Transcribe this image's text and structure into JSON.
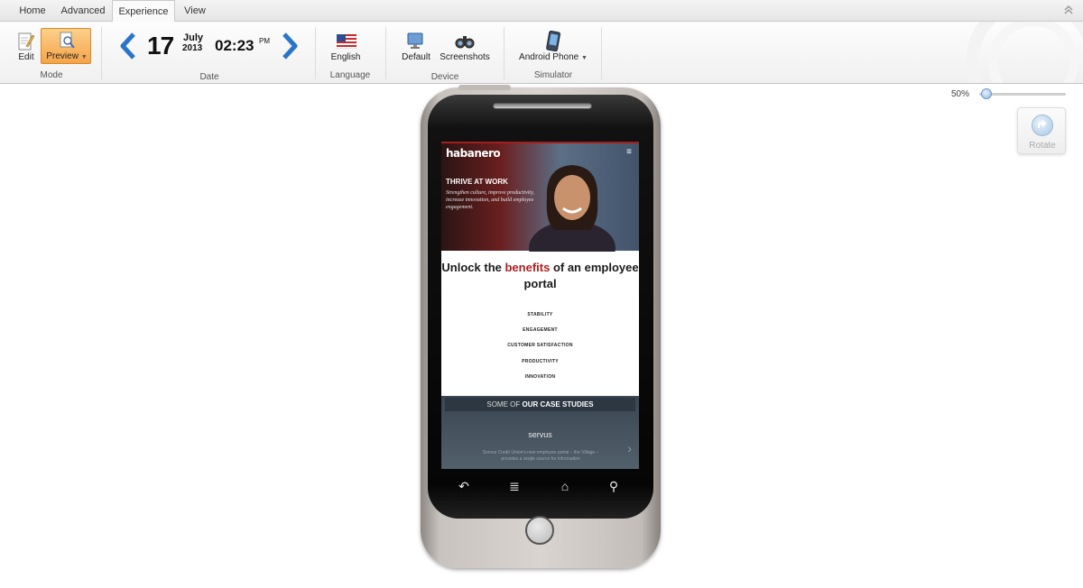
{
  "tabs": [
    "Home",
    "Advanced",
    "Experience",
    "View"
  ],
  "active_tab": "Experience",
  "ribbon": {
    "mode": {
      "edit_label": "Edit",
      "preview_label": "Preview",
      "group_label": "Mode"
    },
    "date": {
      "day": "17",
      "month": "July",
      "year": "2013",
      "time": "02:23",
      "ampm": "PM",
      "group_label": "Date"
    },
    "language": {
      "label": "English",
      "group_label": "Language"
    },
    "device": {
      "default_label": "Default",
      "screenshots_label": "Screenshots",
      "group_label": "Device"
    },
    "simulator": {
      "label": "Android Phone",
      "group_label": "Simulator"
    }
  },
  "zoom": {
    "label": "50%",
    "value": 0.5
  },
  "rotate": {
    "label": "Rotate"
  },
  "site": {
    "logo": "habanero",
    "menu_icon": "≡",
    "hero_title": "THRIVE AT WORK",
    "hero_subtitle": "Strengthen culture, improve productivity, increase innovation, and build employee engagement.",
    "headline_pre": "Unlock the ",
    "headline_em": "benefits",
    "headline_post": " of an employee portal",
    "benefits": [
      "STABILITY",
      "ENGAGEMENT",
      "CUSTOMER SATISFACTION",
      "PRODUCTIVITY",
      "INNOVATION"
    ],
    "case_studies_pre": "SOME OF ",
    "case_studies_bold": "OUR CASE STUDIES",
    "case_logo": "servus",
    "case_text": "Servus Credit Union's new employee portal – the Village – provides a single source for information"
  },
  "colors": {
    "accent_red": "#b01e1e",
    "preview_orange": "#f5a44a",
    "nav_blue": "#2a74c9"
  }
}
